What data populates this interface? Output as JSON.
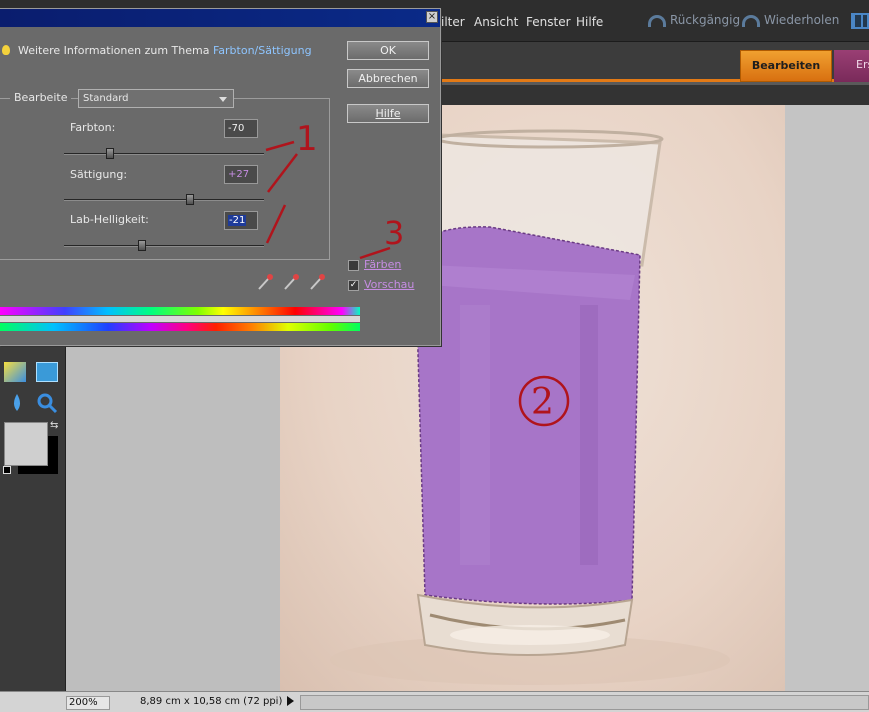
{
  "menubar": {
    "items": [
      "ilter",
      "Ansicht",
      "Fenster",
      "Hilfe"
    ],
    "undo_label": "Rückgängig",
    "redo_label": "Wiederholen"
  },
  "modebar": {
    "tab_edit": "Bearbeiten",
    "tab_create": "Ers"
  },
  "dialog": {
    "info_text": "Weitere Informationen zum Thema",
    "info_link": "Farbton/Sättigung",
    "ok_label": "OK",
    "cancel_label": "Abbrechen",
    "help_label": "Hilfe",
    "edit_legend": "Bearbeite",
    "edit_value": "Standard",
    "hue": {
      "label": "Farbton:",
      "value": "-70",
      "position": 0.23
    },
    "saturation": {
      "label": "Sättigung:",
      "value": "+27",
      "position": 0.63
    },
    "lightness": {
      "label": "Lab-Helligkeit:",
      "value": "-21",
      "position": 0.39
    },
    "colorize_label": "Färben",
    "colorize_checked": false,
    "preview_label": "Vorschau",
    "preview_checked": true
  },
  "annotations": {
    "one": "1",
    "two": "2",
    "three": "3"
  },
  "statusbar": {
    "zoom": "200%",
    "doc_size": "8,89 cm x 10,58 cm (72 ppi)"
  },
  "colors": {
    "accent_orange": "#e37a16",
    "purple_liquid": "#a775c8",
    "annotation_red": "#b0141c",
    "link_blue": "#8ec5ff"
  }
}
